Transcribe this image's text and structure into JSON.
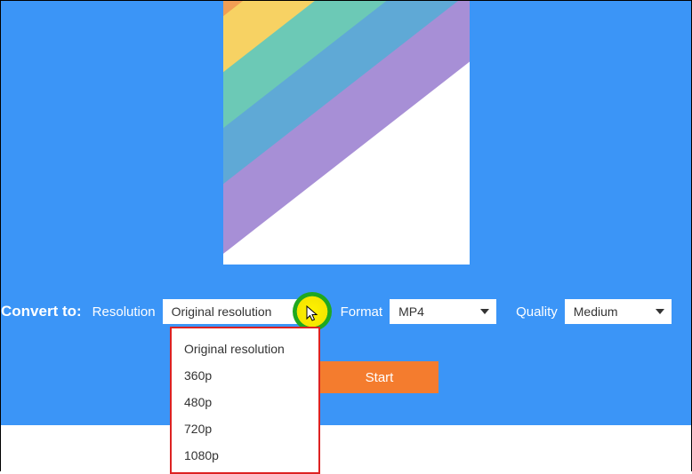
{
  "convert_label": "Convert to:",
  "resolution": {
    "label": "Resolution",
    "selected": "Original resolution",
    "options": [
      "Original resolution",
      "360p",
      "480p",
      "720p",
      "1080p"
    ]
  },
  "format": {
    "label": "Format",
    "selected": "MP4"
  },
  "quality": {
    "label": "Quality",
    "selected": "Medium"
  },
  "start_label": "Start",
  "colors": {
    "bg": "#3b95f7",
    "start_btn": "#f47c2e",
    "highlight": "#fff200",
    "dropdown_border": "#d22"
  }
}
